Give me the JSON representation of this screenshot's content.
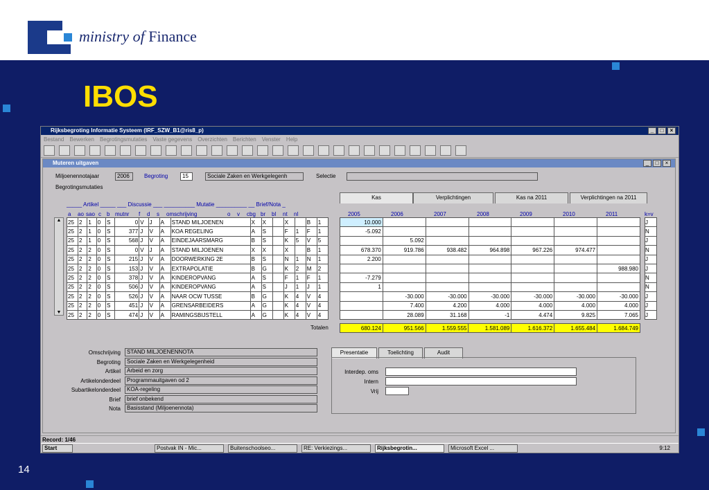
{
  "brand": {
    "ministry": "ministry",
    "of": "of",
    "finance": "Finance"
  },
  "slide": {
    "title": "IBOS",
    "page": "14"
  },
  "app": {
    "title": "Rijksbegroting Informatie Systeem (IRF_SZW_B1@ris8_p)",
    "menu": [
      "Bestand",
      "Bewerken",
      "Begrotingsmutaties",
      "Vaste gegevens",
      "Overzichten",
      "Berichten",
      "Venster",
      "Help"
    ],
    "status": "Record: 1/46"
  },
  "form": {
    "title": "Muteren uitgaven",
    "miljoenennota_label": "Miljoenennotajaar",
    "miljoenennota_value": "2006",
    "begroting_label": "Begroting",
    "begroting_value": "15",
    "begroting_name": "Sociale Zaken en Werkgelegenh",
    "selectie_label": "Selectie",
    "mutaties_label": "Begrotingsmutaties",
    "group_headers": "_____ Artikel _____ ___ Discussie ___ __________ Mutatie __________ __ Brief/Nota _",
    "columns": [
      "a",
      "ao",
      "sao",
      "c",
      "b",
      "mutnr",
      "f",
      "d",
      "s",
      "omschrijving",
      "o",
      "v",
      "cbg",
      "br",
      "bl",
      "nt",
      "nl"
    ],
    "tabs": [
      "Kas",
      "Verplichtingen",
      "Kas na 2011",
      "Verplichtingen na 2011"
    ],
    "years": [
      "2005",
      "2006",
      "2007",
      "2008",
      "2009",
      "2010",
      "2011"
    ],
    "kv_label": "k=v",
    "rows": [
      [
        "25",
        "2",
        "1",
        "0",
        "S",
        "0",
        "V",
        "J",
        "A",
        "STAND MILJOENEN",
        "X",
        "X",
        "",
        "X",
        "",
        "B",
        "1"
      ],
      [
        "25",
        "2",
        "1",
        "0",
        "S",
        "377",
        "J",
        "V",
        "A",
        "KOA REGELING",
        "A",
        "S",
        "",
        "F",
        "1",
        "F",
        "1"
      ],
      [
        "25",
        "2",
        "1",
        "0",
        "S",
        "568",
        "J",
        "V",
        "A",
        "EINDEJAARSMARG",
        "B",
        "S",
        "",
        "K",
        "5",
        "V",
        "5"
      ],
      [
        "25",
        "2",
        "2",
        "0",
        "S",
        "0",
        "V",
        "J",
        "A",
        "STAND MILJOENEN",
        "X",
        "X",
        "",
        "X",
        "",
        "B",
        "1"
      ],
      [
        "25",
        "2",
        "2",
        "0",
        "S",
        "215",
        "J",
        "V",
        "A",
        "DOORWERKING 2E",
        "B",
        "S",
        "",
        "N",
        "1",
        "N",
        "1"
      ],
      [
        "25",
        "2",
        "2",
        "0",
        "S",
        "153",
        "J",
        "V",
        "A",
        "EXTRAPOLATIE",
        "B",
        "G",
        "",
        "K",
        "2",
        "M",
        "2"
      ],
      [
        "25",
        "2",
        "2",
        "0",
        "S",
        "378",
        "J",
        "V",
        "A",
        "KINDEROPVANG",
        "A",
        "S",
        "",
        "F",
        "1",
        "F",
        "1"
      ],
      [
        "25",
        "2",
        "2",
        "0",
        "S",
        "506",
        "J",
        "V",
        "A",
        "KINDEROPVANG",
        "A",
        "S",
        "",
        "J",
        "1",
        "J",
        "1"
      ],
      [
        "25",
        "2",
        "2",
        "0",
        "S",
        "526",
        "J",
        "V",
        "A",
        "NAAR OCW TUSSE",
        "B",
        "G",
        "",
        "K",
        "4",
        "V",
        "4"
      ],
      [
        "25",
        "2",
        "2",
        "0",
        "S",
        "451",
        "J",
        "V",
        "A",
        "GRENSARBEIDERS",
        "A",
        "G",
        "",
        "K",
        "4",
        "V",
        "4"
      ],
      [
        "25",
        "2",
        "2",
        "0",
        "S",
        "474",
        "J",
        "V",
        "A",
        "RAMINGSBIJSTELL",
        "A",
        "G",
        "",
        "K",
        "4",
        "V",
        "4"
      ]
    ],
    "amounts": [
      [
        "10.000",
        "",
        "",
        "",
        "",
        "",
        "",
        "J"
      ],
      [
        "-5.092",
        "",
        "",
        "",
        "",
        "",
        "",
        "N"
      ],
      [
        "",
        "5.092",
        "",
        "",
        "",
        "",
        "",
        "J"
      ],
      [
        "678.370",
        "919.786",
        "938.482",
        "964.898",
        "967.226",
        "974.477",
        "",
        "N"
      ],
      [
        "2.200",
        "",
        "",
        "",
        "",
        "",
        "",
        "J"
      ],
      [
        "",
        "",
        "",
        "",
        "",
        "",
        "988.980",
        "J"
      ],
      [
        "-7.279",
        "",
        "",
        "",
        "",
        "",
        "",
        "N"
      ],
      [
        "1",
        "",
        "",
        "",
        "",
        "",
        "",
        "N"
      ],
      [
        "",
        "-30.000",
        "-30.000",
        "-30.000",
        "-30.000",
        "-30.000",
        "-30.000",
        "J"
      ],
      [
        "",
        "7.400",
        "4.200",
        "4.000",
        "4.000",
        "4.000",
        "4.000",
        "J"
      ],
      [
        "",
        "28.089",
        "31.168",
        "-1",
        "4.474",
        "9.825",
        "7.065",
        "J"
      ]
    ],
    "totals_label": "Totalen",
    "totals": [
      "680.124",
      "951.566",
      "1.559.555",
      "1.581.089",
      "1.616.372",
      "1.655.484",
      "1.684.749"
    ],
    "detail": [
      {
        "label": "Omschrijving",
        "value": "STAND MILJOENENNOTA"
      },
      {
        "label": "Begroting",
        "value": "Sociale Zaken en Werkgelegenheid"
      },
      {
        "label": "Artikel",
        "value": "Arbeid en zorg"
      },
      {
        "label": "Artikelonderdeel",
        "value": "Programmauitgaven od 2"
      },
      {
        "label": "Subartikelonderdeel",
        "value": "KOA-regeling"
      },
      {
        "label": "Brief",
        "value": "brief onbekend"
      },
      {
        "label": "Nota",
        "value": "Basisstand (Miljoenennota)"
      }
    ],
    "lower_tabs": [
      "Presentatie",
      "Toelichting",
      "Audit"
    ],
    "lower_fields": [
      {
        "label": "Interdep. oms",
        "value": ""
      },
      {
        "label": "Intern",
        "value": ""
      },
      {
        "label": "Vrij",
        "value": ""
      }
    ]
  },
  "taskbar": {
    "start": "Start",
    "items": [
      "Postvak IN - Mic...",
      "Buitenschoolseo...",
      "RE: Verkiezings...",
      "Rijksbegrotin...",
      "Microsoft Excel ..."
    ],
    "clock": "9:12"
  },
  "colors": {
    "background": "#0f1d66",
    "title": "#ffde00",
    "highlight": "#ffff00",
    "accent": "#2a86d6"
  }
}
